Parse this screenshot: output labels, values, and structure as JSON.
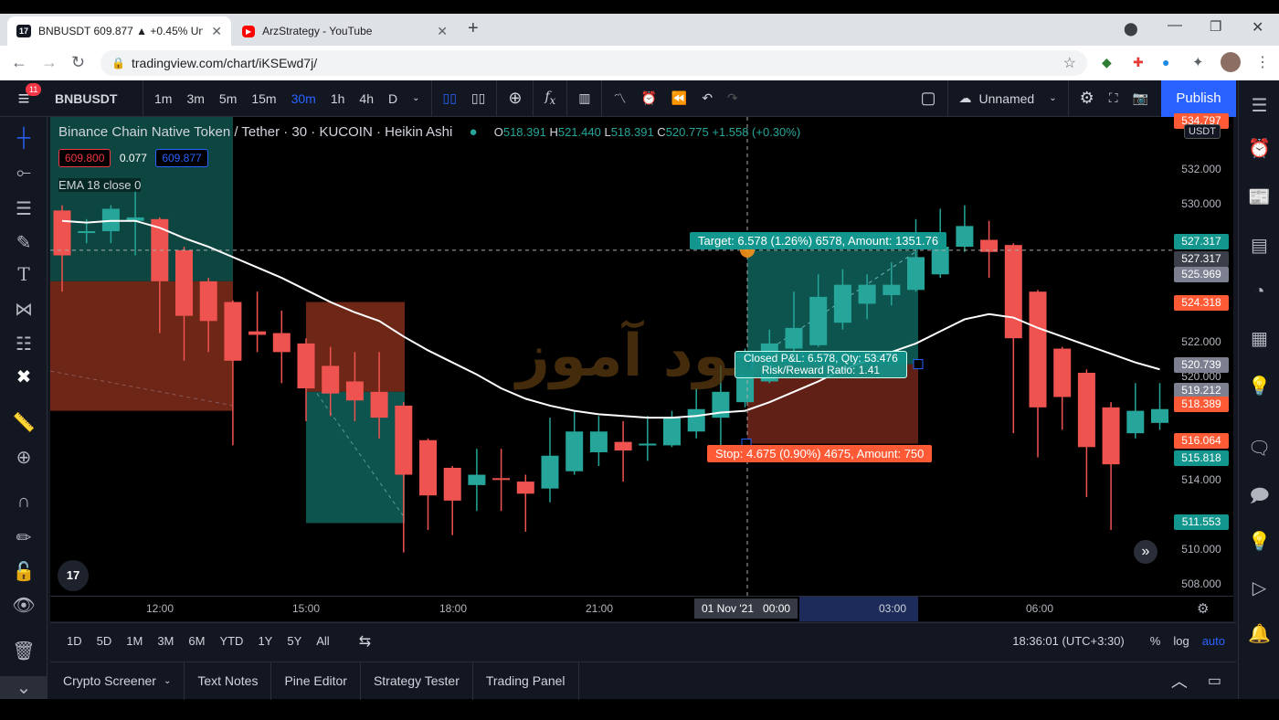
{
  "browser": {
    "tabs": [
      {
        "title": "BNBUSDT 609.877 ▲ +0.45% Un",
        "icon": "tradingview-icon",
        "active": true
      },
      {
        "title": "ArzStrategy - YouTube",
        "icon": "youtube-icon",
        "active": false
      }
    ],
    "new_tab": "+",
    "url": "tradingview.com/chart/iKSEwd7j/"
  },
  "toolbar": {
    "menu_badge": "11",
    "symbol": "BNBUSDT",
    "intervals": [
      "1m",
      "3m",
      "5m",
      "15m",
      "30m",
      "1h",
      "4h",
      "D"
    ],
    "active_interval": "30m",
    "layout_name": "Unnamed",
    "publish": "Publish"
  },
  "legend": {
    "title": "Binance Chain Native Token / Tether · 30 · KUCOIN · Heikin Ashi",
    "o": "518.391",
    "h": "521.440",
    "l": "518.391",
    "c": "520.775",
    "change": "+1.558 (+0.30%)",
    "bid": "609.800",
    "spread": "0.077",
    "ask": "609.877",
    "indicator": "EMA 18 close 0"
  },
  "watermark": "سود آموز",
  "colors": {
    "up": "#26a69a",
    "down": "#ef5350",
    "ema": "#ffffff",
    "accent": "#2962ff",
    "target_zone": "#0e5c57",
    "stop_zone": "#6b2418"
  },
  "position": {
    "target_label": "Target: 6.578 (1.26%) 6578, Amount: 1351.76",
    "stop_label": "Stop: 4.675 (0.90%) 4675, Amount: 750",
    "pnl_label": "Closed P&L: 6.578, Qty: 53.476",
    "rr_label": "Risk/Reward Ratio: 1.41"
  },
  "price_axis": {
    "currency": "USDT",
    "ticks": [
      "532.000",
      "530.000",
      "522.000",
      "520.000",
      "514.000",
      "510.000",
      "508.000"
    ],
    "tick_values": [
      532,
      530,
      522,
      520,
      514,
      510,
      508
    ],
    "labels": [
      {
        "text": "534.797",
        "value": 534.8,
        "color": "#ff5a36"
      },
      {
        "text": "527.317",
        "value": 527.8,
        "color": "#13968d"
      },
      {
        "text": "527.317",
        "value": 526.8,
        "color": "#3b3f4a"
      },
      {
        "text": "525.969",
        "value": 525.9,
        "color": "#7c8090"
      },
      {
        "text": "524.318",
        "value": 524.3,
        "color": "#ff5a36"
      },
      {
        "text": "520.739",
        "value": 520.7,
        "color": "#7c8090"
      },
      {
        "text": "519.212",
        "value": 519.2,
        "color": "#7c8090"
      },
      {
        "text": "518.389",
        "value": 518.4,
        "color": "#ff5a36"
      },
      {
        "text": "516.064",
        "value": 516.3,
        "color": "#ff5a36"
      },
      {
        "text": "515.818",
        "value": 515.3,
        "color": "#13968d"
      },
      {
        "text": "511.553",
        "value": 511.6,
        "color": "#13968d"
      }
    ]
  },
  "time_axis": {
    "ticks": [
      "12:00",
      "15:00",
      "18:00",
      "21:00",
      "03:00",
      "06:00"
    ],
    "cursor_date": "01 Nov '21",
    "cursor_time": "00:00"
  },
  "range_bar": {
    "ranges": [
      "1D",
      "5D",
      "1M",
      "3M",
      "6M",
      "YTD",
      "1Y",
      "5Y",
      "All"
    ],
    "clock": "18:36:01 (UTC+3:30)",
    "percent": "%",
    "log": "log",
    "auto": "auto"
  },
  "bottom_panel": {
    "tabs": [
      "Crypto Screener",
      "Text Notes",
      "Pine Editor",
      "Strategy Tester",
      "Trading Panel"
    ]
  },
  "chart_data": {
    "type": "candlestick",
    "style": "Heikin Ashi",
    "interval_minutes": 30,
    "first_candle_time": "10:00",
    "ylim": [
      507,
      535.5
    ],
    "candles": [
      [
        529.6,
        529.9,
        524.9,
        527.0
      ],
      [
        528.3,
        529.1,
        527.7,
        528.4
      ],
      [
        528.4,
        529.9,
        527.7,
        529.7
      ],
      [
        529.0,
        530.7,
        527.0,
        529.2
      ],
      [
        529.1,
        529.2,
        522.5,
        525.5
      ],
      [
        527.3,
        527.5,
        520.9,
        523.5
      ],
      [
        525.5,
        525.7,
        521.4,
        523.2
      ],
      [
        524.3,
        524.4,
        516.0,
        520.9
      ],
      [
        522.6,
        524.9,
        521.4,
        522.4
      ],
      [
        522.5,
        523.8,
        519.6,
        521.4
      ],
      [
        521.9,
        522.2,
        517.4,
        519.3
      ],
      [
        520.6,
        521.7,
        517.7,
        519.0
      ],
      [
        519.7,
        521.4,
        517.4,
        518.6
      ],
      [
        519.1,
        521.4,
        516.4,
        517.6
      ],
      [
        518.3,
        518.5,
        509.8,
        514.3
      ],
      [
        516.3,
        516.4,
        511.1,
        513.1
      ],
      [
        514.7,
        514.8,
        510.8,
        512.8
      ],
      [
        513.7,
        515.8,
        512.2,
        514.3
      ],
      [
        514.1,
        515.8,
        512.2,
        514.0
      ],
      [
        513.9,
        514.3,
        511.0,
        513.2
      ],
      [
        513.5,
        517.6,
        512.7,
        515.4
      ],
      [
        514.5,
        518.0,
        514.3,
        516.8
      ],
      [
        515.6,
        517.7,
        514.8,
        516.8
      ],
      [
        516.2,
        517.4,
        513.9,
        515.7
      ],
      [
        516.0,
        517.7,
        515.1,
        516.1
      ],
      [
        516.0,
        518.0,
        515.9,
        517.6
      ],
      [
        516.8,
        519.3,
        516.4,
        518.1
      ],
      [
        517.6,
        520.6,
        515.9,
        519.1
      ],
      [
        518.5,
        521.6,
        518.2,
        521.3
      ],
      [
        519.7,
        522.7,
        519.6,
        521.9
      ],
      [
        521.6,
        524.9,
        521.2,
        522.8
      ],
      [
        521.8,
        525.9,
        521.7,
        524.6
      ],
      [
        523.1,
        526.2,
        522.7,
        525.3
      ],
      [
        524.2,
        525.9,
        523.3,
        525.3
      ],
      [
        524.7,
        526.6,
        524.1,
        525.3
      ],
      [
        525.0,
        529.1,
        524.9,
        526.9
      ],
      [
        525.9,
        529.7,
        525.7,
        527.5
      ],
      [
        527.5,
        529.9,
        527.2,
        528.7
      ],
      [
        527.9,
        529.0,
        525.7,
        527.2
      ],
      [
        527.6,
        527.7,
        516.7,
        522.2
      ],
      [
        524.9,
        525.0,
        515.3,
        518.2
      ],
      [
        521.6,
        521.7,
        516.9,
        518.8
      ],
      [
        520.2,
        520.4,
        513.0,
        515.9
      ],
      [
        518.2,
        518.5,
        511.1,
        514.9
      ],
      [
        516.7,
        519.6,
        516.4,
        518.0
      ],
      [
        517.3,
        519.6,
        516.9,
        518.1
      ]
    ],
    "ema18": [
      529.0,
      528.9,
      529.0,
      529.0,
      528.6,
      528.0,
      527.5,
      526.9,
      526.3,
      525.7,
      525.0,
      524.3,
      523.7,
      523.2,
      522.3,
      521.5,
      520.8,
      520.1,
      519.3,
      518.7,
      518.3,
      518.0,
      517.8,
      517.7,
      517.6,
      517.6,
      517.7,
      517.9,
      518.0,
      518.5,
      519.1,
      519.7,
      520.4,
      520.9,
      521.4,
      521.9,
      522.6,
      523.3,
      523.6,
      523.4,
      522.8,
      522.3,
      521.8,
      521.3,
      520.8,
      520.4
    ]
  }
}
